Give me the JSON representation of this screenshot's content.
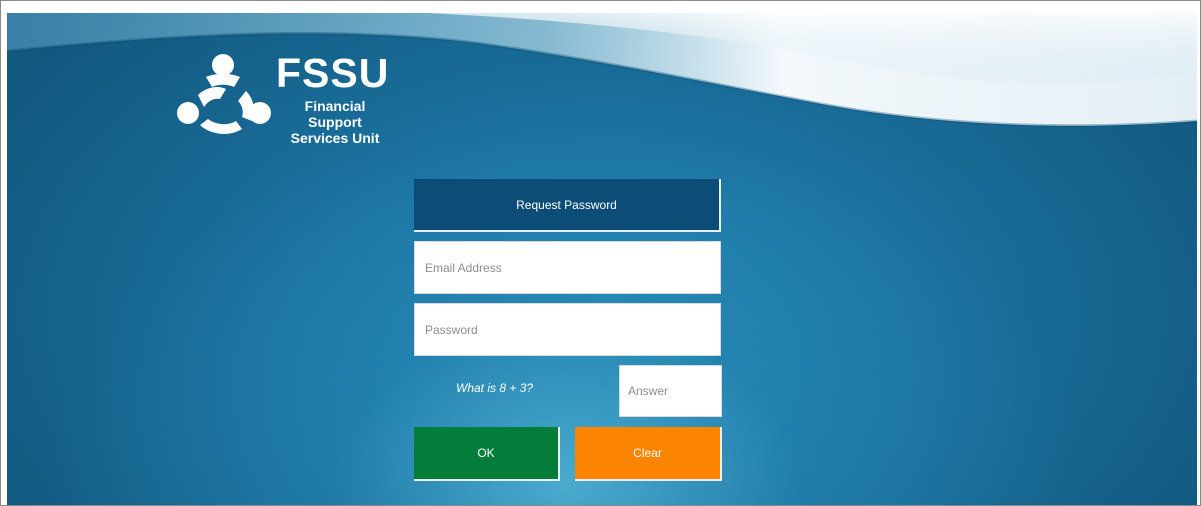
{
  "logo": {
    "title": "FSSU",
    "subtitle_line1": "Financial Support",
    "subtitle_line2": "Services Unit"
  },
  "form": {
    "request_password_label": "Request Password",
    "email_placeholder": "Email Address",
    "password_placeholder": "Password",
    "captcha_question": "What is 8 + 3?",
    "answer_placeholder": "Answer",
    "ok_label": "OK",
    "clear_label": "Clear"
  },
  "colors": {
    "background": "#1c74a2",
    "request_button": "#0b4d76",
    "ok_button": "#047d3a",
    "clear_button": "#fb8400"
  }
}
